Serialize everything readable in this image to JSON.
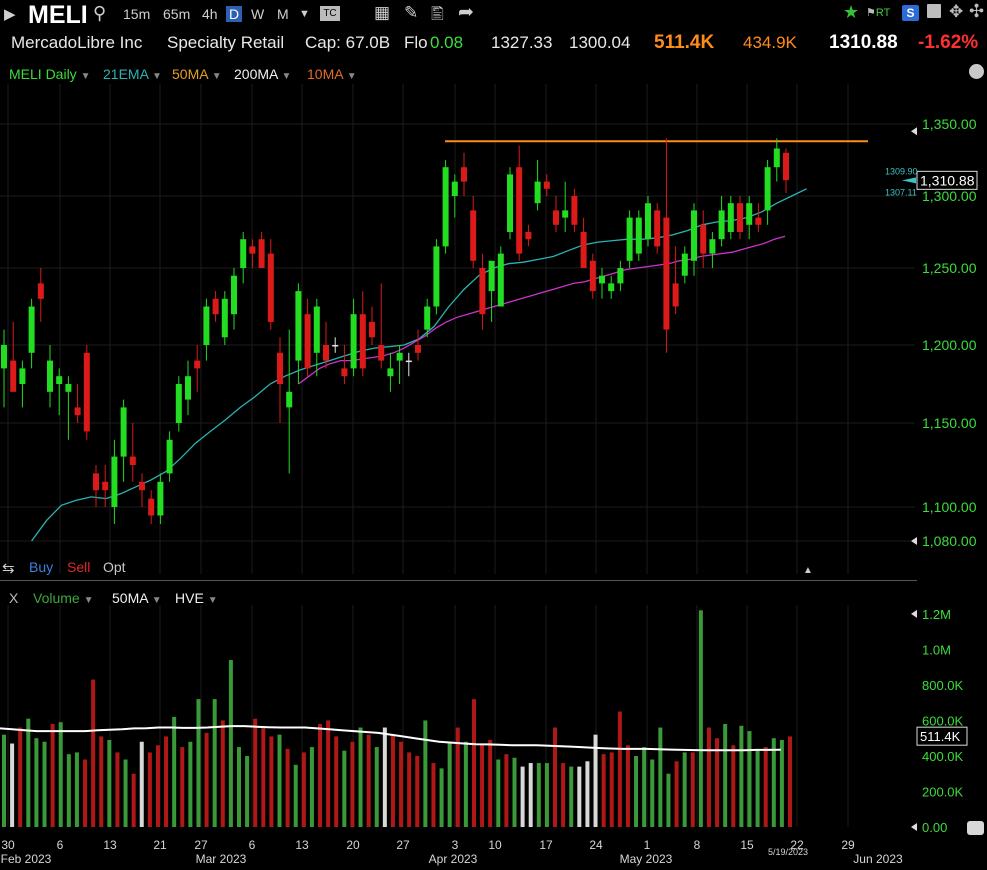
{
  "toolbar": {
    "symbol": "MELI",
    "timeframes": [
      "15m",
      "65m",
      "4h",
      "D",
      "W",
      "M"
    ],
    "active_timeframe": "D",
    "rt_label": "RT"
  },
  "info": {
    "company": "MercadoLibre Inc",
    "sector": "Specialty Retail",
    "cap": "Cap: 67.0B",
    "float_label": "Flo",
    "change_small": "0.08",
    "high": "1327.33",
    "low": "1300.04",
    "volume": "511.4K",
    "avg_volume": "434.9K",
    "last": "1310.88",
    "change_pct": "-1.62%"
  },
  "studies": {
    "main": "MELI Daily",
    "ema21": "21EMA",
    "ma50": "50MA",
    "ma200": "200MA",
    "ma10": "10MA"
  },
  "trade": {
    "buy": "Buy",
    "sell": "Sell",
    "opt": "Opt"
  },
  "volume_panel": {
    "close": "X",
    "title": "Volume",
    "ma": "50MA",
    "hve": "HVE"
  },
  "colors": {
    "up": "#22dd22",
    "down": "#dd1a1a",
    "neutral": "#e6e6e6",
    "ema21": "#2bb3b3",
    "ma50": "#cc33cc",
    "resistance": "#ff8c1a",
    "axis_green": "#3cdc3c",
    "vol_up": "#3a9a3a",
    "vol_down": "#b01818"
  },
  "chart_data": {
    "type": "candlestick",
    "title": "MELI Daily",
    "y_axis": {
      "ticks": [
        1080,
        1100,
        1150,
        1200,
        1250,
        1300,
        1350
      ],
      "tick_labels": [
        "1,080.00",
        "1,100.00",
        "1,150.00",
        "1,200.00",
        "1,250.00",
        "1,300.00",
        "1,350.00"
      ],
      "ylim": [
        1070,
        1365
      ],
      "scale": "log"
    },
    "x_axis": {
      "tick_labels": [
        "30",
        "6",
        "13",
        "21",
        "27",
        "6",
        "13",
        "20",
        "27",
        "3",
        "10",
        "17",
        "24",
        "1",
        "8",
        "15",
        "22",
        "29"
      ],
      "month_labels": [
        "Feb 2023",
        "Mar 2023",
        "Apr 2023",
        "May 2023",
        "Jun 2023"
      ],
      "current_date_label": "5/19/2023"
    },
    "markers": {
      "last": "1,310.88",
      "marker_high": "1309.90",
      "marker_low": "1307.11"
    },
    "resistance_line": 1338,
    "candles": [
      {
        "o": 1185,
        "h": 1210,
        "l": 1160,
        "c": 1200
      },
      {
        "o": 1190,
        "h": 1215,
        "l": 1170,
        "c": 1170
      },
      {
        "o": 1175,
        "h": 1190,
        "l": 1160,
        "c": 1185
      },
      {
        "o": 1195,
        "h": 1230,
        "l": 1185,
        "c": 1225
      },
      {
        "o": 1240,
        "h": 1250,
        "l": 1215,
        "c": 1230
      },
      {
        "o": 1170,
        "h": 1200,
        "l": 1160,
        "c": 1190
      },
      {
        "o": 1175,
        "h": 1185,
        "l": 1155,
        "c": 1180
      },
      {
        "o": 1170,
        "h": 1180,
        "l": 1140,
        "c": 1175
      },
      {
        "o": 1160,
        "h": 1175,
        "l": 1150,
        "c": 1155
      },
      {
        "o": 1195,
        "h": 1200,
        "l": 1140,
        "c": 1145
      },
      {
        "o": 1120,
        "h": 1125,
        "l": 1100,
        "c": 1110
      },
      {
        "o": 1115,
        "h": 1125,
        "l": 1100,
        "c": 1110
      },
      {
        "o": 1100,
        "h": 1140,
        "l": 1090,
        "c": 1130
      },
      {
        "o": 1130,
        "h": 1165,
        "l": 1115,
        "c": 1160
      },
      {
        "o": 1130,
        "h": 1150,
        "l": 1115,
        "c": 1125
      },
      {
        "o": 1115,
        "h": 1120,
        "l": 1100,
        "c": 1110
      },
      {
        "o": 1105,
        "h": 1110,
        "l": 1090,
        "c": 1095
      },
      {
        "o": 1095,
        "h": 1120,
        "l": 1090,
        "c": 1115
      },
      {
        "o": 1120,
        "h": 1145,
        "l": 1115,
        "c": 1140
      },
      {
        "o": 1150,
        "h": 1180,
        "l": 1145,
        "c": 1175
      },
      {
        "o": 1165,
        "h": 1190,
        "l": 1155,
        "c": 1180
      },
      {
        "o": 1190,
        "h": 1200,
        "l": 1170,
        "c": 1185
      },
      {
        "o": 1200,
        "h": 1230,
        "l": 1190,
        "c": 1225
      },
      {
        "o": 1230,
        "h": 1235,
        "l": 1215,
        "c": 1220
      },
      {
        "o": 1205,
        "h": 1235,
        "l": 1200,
        "c": 1230
      },
      {
        "o": 1220,
        "h": 1250,
        "l": 1210,
        "c": 1245
      },
      {
        "o": 1250,
        "h": 1275,
        "l": 1240,
        "c": 1270
      },
      {
        "o": 1265,
        "h": 1270,
        "l": 1250,
        "c": 1260
      },
      {
        "o": 1270,
        "h": 1275,
        "l": 1250,
        "c": 1250
      },
      {
        "o": 1260,
        "h": 1270,
        "l": 1210,
        "c": 1215
      },
      {
        "o": 1195,
        "h": 1205,
        "l": 1150,
        "c": 1175
      },
      {
        "o": 1160,
        "h": 1210,
        "l": 1120,
        "c": 1170
      },
      {
        "o": 1190,
        "h": 1240,
        "l": 1175,
        "c": 1235
      },
      {
        "o": 1220,
        "h": 1230,
        "l": 1180,
        "c": 1185
      },
      {
        "o": 1195,
        "h": 1230,
        "l": 1180,
        "c": 1225
      },
      {
        "o": 1200,
        "h": 1215,
        "l": 1185,
        "c": 1190
      },
      {
        "o": 1200,
        "h": 1205,
        "l": 1195,
        "c": 1200
      },
      {
        "o": 1185,
        "h": 1200,
        "l": 1175,
        "c": 1180
      },
      {
        "o": 1185,
        "h": 1230,
        "l": 1180,
        "c": 1220
      },
      {
        "o": 1220,
        "h": 1235,
        "l": 1180,
        "c": 1185
      },
      {
        "o": 1215,
        "h": 1225,
        "l": 1200,
        "c": 1205
      },
      {
        "o": 1200,
        "h": 1240,
        "l": 1185,
        "c": 1190
      },
      {
        "o": 1180,
        "h": 1195,
        "l": 1170,
        "c": 1185
      },
      {
        "o": 1190,
        "h": 1200,
        "l": 1175,
        "c": 1195
      },
      {
        "o": 1190,
        "h": 1195,
        "l": 1180,
        "c": 1190
      },
      {
        "o": 1200,
        "h": 1210,
        "l": 1190,
        "c": 1195
      },
      {
        "o": 1210,
        "h": 1230,
        "l": 1205,
        "c": 1225
      },
      {
        "o": 1225,
        "h": 1270,
        "l": 1220,
        "c": 1265
      },
      {
        "o": 1265,
        "h": 1325,
        "l": 1260,
        "c": 1320
      },
      {
        "o": 1300,
        "h": 1315,
        "l": 1285,
        "c": 1310
      },
      {
        "o": 1320,
        "h": 1330,
        "l": 1300,
        "c": 1310
      },
      {
        "o": 1290,
        "h": 1300,
        "l": 1250,
        "c": 1255
      },
      {
        "o": 1250,
        "h": 1260,
        "l": 1210,
        "c": 1220
      },
      {
        "o": 1235,
        "h": 1250,
        "l": 1215,
        "c": 1255
      },
      {
        "o": 1225,
        "h": 1265,
        "l": 1225,
        "c": 1260
      },
      {
        "o": 1275,
        "h": 1320,
        "l": 1270,
        "c": 1315
      },
      {
        "o": 1320,
        "h": 1335,
        "l": 1255,
        "c": 1260
      },
      {
        "o": 1275,
        "h": 1280,
        "l": 1265,
        "c": 1270
      },
      {
        "o": 1295,
        "h": 1325,
        "l": 1290,
        "c": 1310
      },
      {
        "o": 1310,
        "h": 1315,
        "l": 1300,
        "c": 1305
      },
      {
        "o": 1290,
        "h": 1300,
        "l": 1275,
        "c": 1280
      },
      {
        "o": 1285,
        "h": 1310,
        "l": 1275,
        "c": 1290
      },
      {
        "o": 1300,
        "h": 1305,
        "l": 1275,
        "c": 1280
      },
      {
        "o": 1275,
        "h": 1285,
        "l": 1250,
        "c": 1250
      },
      {
        "o": 1255,
        "h": 1260,
        "l": 1230,
        "c": 1235
      },
      {
        "o": 1240,
        "h": 1250,
        "l": 1230,
        "c": 1245
      },
      {
        "o": 1235,
        "h": 1245,
        "l": 1230,
        "c": 1240
      },
      {
        "o": 1240,
        "h": 1255,
        "l": 1235,
        "c": 1250
      },
      {
        "o": 1255,
        "h": 1290,
        "l": 1250,
        "c": 1285
      },
      {
        "o": 1260,
        "h": 1290,
        "l": 1255,
        "c": 1285
      },
      {
        "o": 1270,
        "h": 1300,
        "l": 1265,
        "c": 1295
      },
      {
        "o": 1290,
        "h": 1295,
        "l": 1260,
        "c": 1265
      },
      {
        "o": 1285,
        "h": 1340,
        "l": 1195,
        "c": 1210
      },
      {
        "o": 1240,
        "h": 1265,
        "l": 1220,
        "c": 1225
      },
      {
        "o": 1245,
        "h": 1265,
        "l": 1240,
        "c": 1260
      },
      {
        "o": 1255,
        "h": 1295,
        "l": 1245,
        "c": 1290
      },
      {
        "o": 1280,
        "h": 1290,
        "l": 1250,
        "c": 1260
      },
      {
        "o": 1260,
        "h": 1275,
        "l": 1250,
        "c": 1270
      },
      {
        "o": 1270,
        "h": 1300,
        "l": 1265,
        "c": 1290
      },
      {
        "o": 1275,
        "h": 1300,
        "l": 1270,
        "c": 1295
      },
      {
        "o": 1295,
        "h": 1300,
        "l": 1270,
        "c": 1275
      },
      {
        "o": 1280,
        "h": 1300,
        "l": 1270,
        "c": 1295
      },
      {
        "o": 1285,
        "h": 1295,
        "l": 1275,
        "c": 1280
      },
      {
        "o": 1290,
        "h": 1325,
        "l": 1280,
        "c": 1320
      },
      {
        "o": 1320,
        "h": 1340,
        "l": 1310,
        "c": 1333
      },
      {
        "o": 1330,
        "h": 1333,
        "l": 1302,
        "c": 1311
      }
    ],
    "ema21": [
      1080,
      1092,
      1101,
      1104,
      1106,
      1105,
      1108,
      1112,
      1116,
      1121,
      1129,
      1138,
      1145,
      1152,
      1160,
      1167,
      1175,
      1180,
      1184,
      1187,
      1190,
      1193,
      1196,
      1198,
      1199,
      1200,
      1204,
      1212,
      1225,
      1236,
      1245,
      1250,
      1253,
      1254,
      1256,
      1258,
      1262,
      1266,
      1268,
      1269,
      1270,
      1270,
      1271,
      1273,
      1276,
      1280,
      1282,
      1283,
      1285,
      1289,
      1295,
      1300,
      1305
    ],
    "ma50": [
      1175,
      1180,
      1185,
      1188,
      1190,
      1190,
      1191,
      1192,
      1193,
      1195,
      1198,
      1202,
      1206,
      1211,
      1215,
      1218,
      1220,
      1222,
      1224,
      1226,
      1228,
      1230,
      1232,
      1234,
      1236,
      1238,
      1240,
      1241,
      1243,
      1245,
      1247,
      1249,
      1250,
      1251,
      1252,
      1253,
      1255,
      1256,
      1258,
      1259,
      1260,
      1261,
      1263,
      1265,
      1267,
      1270,
      1272
    ],
    "volume": {
      "axis_ticks": [
        "1.2M",
        "1.0M",
        "800.0K",
        "600.0K",
        "400.0K",
        "200.0K",
        "0.00"
      ],
      "ylim": [
        0,
        1250000
      ],
      "last_label": "511.4K",
      "values": [
        520,
        470,
        560,
        610,
        500,
        480,
        580,
        590,
        410,
        420,
        380,
        830,
        510,
        490,
        420,
        380,
        300,
        480,
        420,
        460,
        510,
        620,
        450,
        480,
        720,
        530,
        720,
        600,
        940,
        450,
        400,
        610,
        560,
        510,
        520,
        440,
        350,
        420,
        450,
        580,
        600,
        510,
        430,
        480,
        560,
        520,
        450,
        560,
        520,
        480,
        420,
        400,
        600,
        360,
        330,
        480,
        560,
        480,
        720,
        470,
        490,
        380,
        410,
        390,
        340,
        360,
        360,
        360,
        560,
        360,
        340,
        340,
        370,
        520,
        410,
        420,
        650,
        460,
        400,
        450,
        380,
        560,
        300,
        370,
        420,
        420,
        1220,
        560,
        500,
        580,
        460,
        570,
        540,
        430,
        450,
        500,
        490,
        510
      ],
      "directions": "gudgggdgggdddgdgdndddgdggdgdgggdddgdgdgdddgdgdgnddddgdggdgdddgdgnnggddgnnnddddgggggdgdgddgdgggdggd",
      "ma50": [
        555,
        550,
        545,
        540,
        540,
        540,
        540,
        540,
        545,
        548,
        550,
        555,
        556,
        560,
        560,
        558,
        558,
        560,
        565,
        568,
        568,
        565,
        562,
        560,
        560,
        560,
        555,
        550,
        545,
        540,
        535,
        530,
        520,
        510,
        500,
        490,
        480,
        475,
        470,
        466,
        465,
        463,
        460,
        460,
        460,
        458,
        455,
        452,
        448,
        445,
        442,
        440,
        440,
        440,
        438,
        436,
        434,
        433,
        432,
        432,
        432,
        432,
        434,
        434,
        435
      ]
    }
  }
}
